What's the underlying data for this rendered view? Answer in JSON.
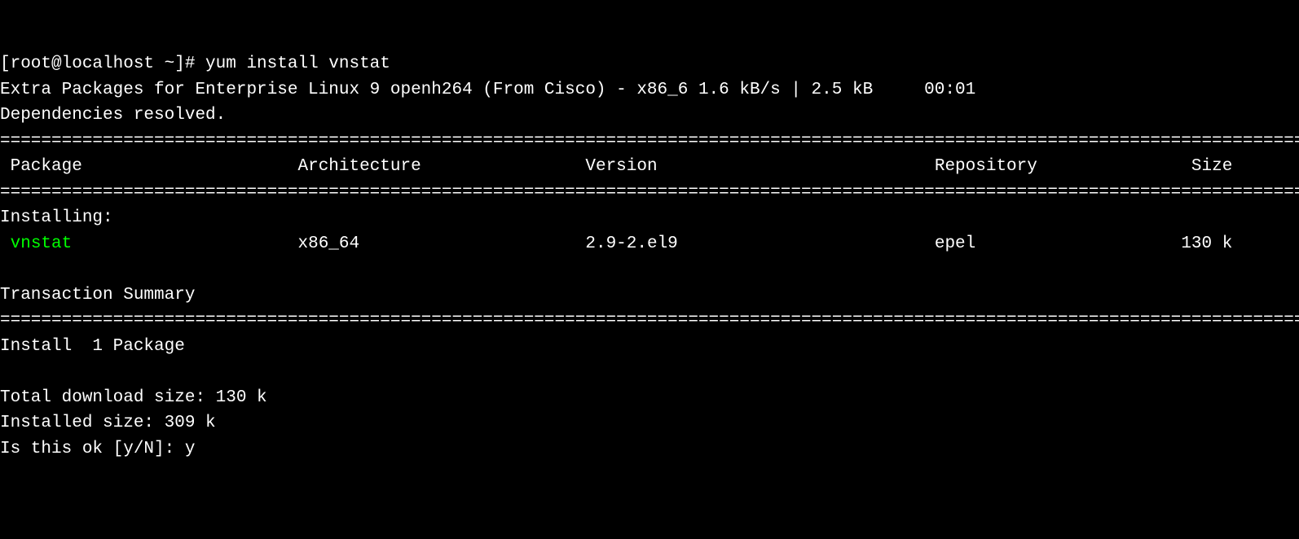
{
  "prompt": "[root@localhost ~]# ",
  "command": "yum install vnstat",
  "repo_line": "Extra Packages for Enterprise Linux 9 openh264 (From Cisco) - x86_6 1.6 kB/s | 2.5 kB     00:01",
  "deps_resolved": "Dependencies resolved.",
  "divider": "================================================================================================================================",
  "headers": {
    "package": " Package",
    "architecture": "Architecture",
    "version": "Version",
    "repository": "Repository",
    "size": "Size"
  },
  "installing_label": "Installing:",
  "pkg": {
    "name": "vnstat",
    "arch": "x86_64",
    "version": "2.9-2.el9",
    "repo": "epel",
    "size": "130 k"
  },
  "transaction_summary": "Transaction Summary",
  "install_count": "Install  1 Package",
  "download_size": "Total download size: 130 k",
  "installed_size": "Installed size: 309 k",
  "confirm_prompt": "Is this ok [y/N]: ",
  "confirm_answer": "y"
}
